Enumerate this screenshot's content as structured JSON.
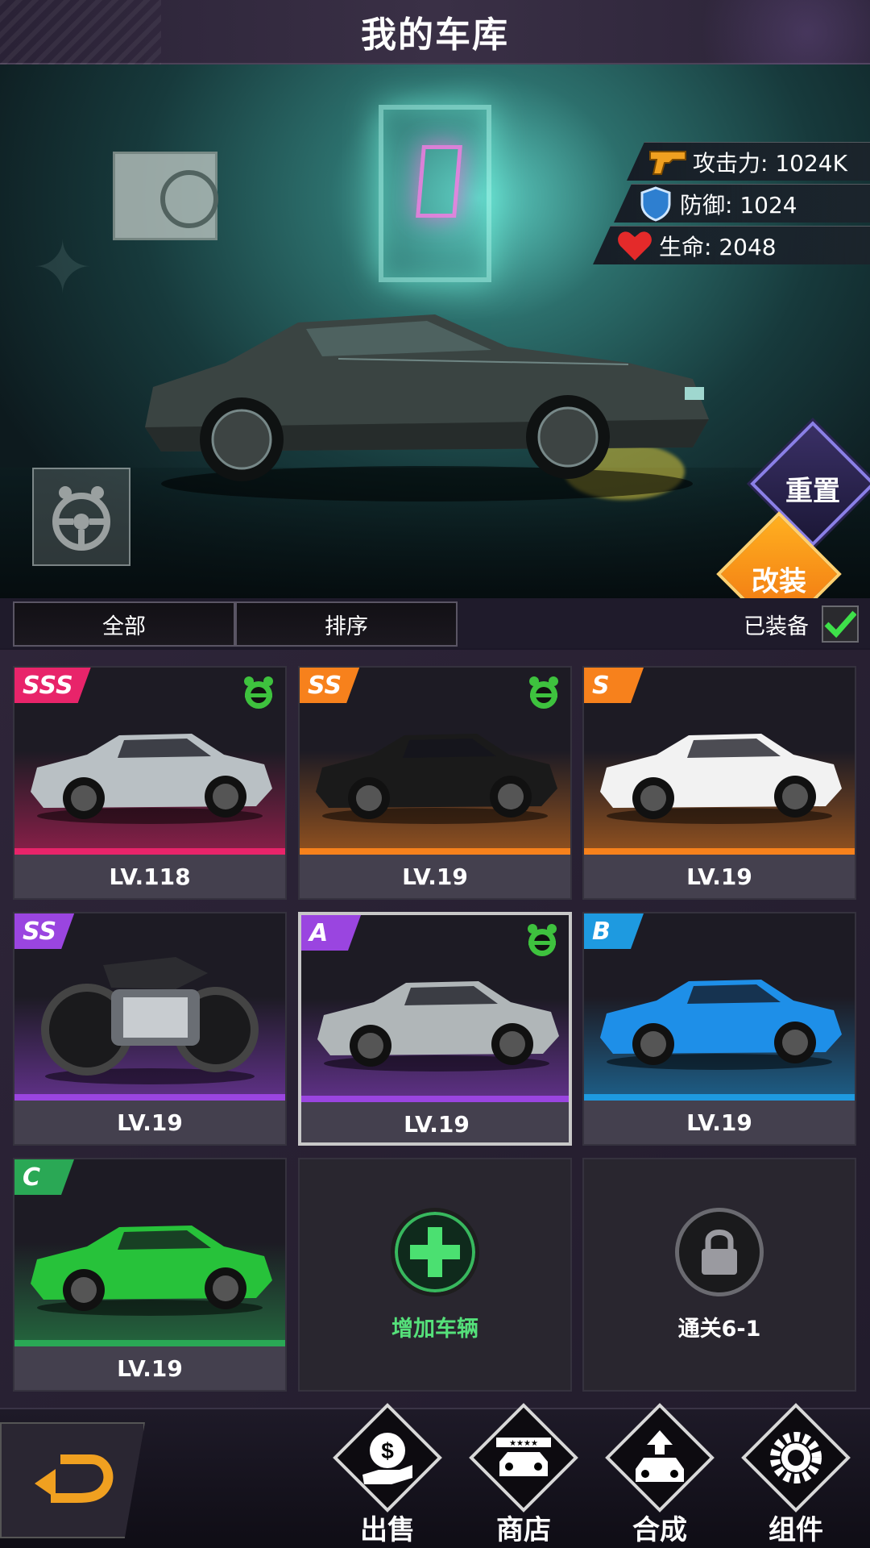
{
  "header": {
    "title": "我的车库"
  },
  "stats": {
    "attack": "攻击力: 1024K",
    "defense": "防御: 1024",
    "life": "生命: 2048"
  },
  "actions": {
    "reset": "重置",
    "modify": "改装"
  },
  "filters": {
    "all": "全部",
    "sort": "排序",
    "equipped_label": "已装备",
    "equipped_checked": true
  },
  "cars": [
    {
      "rank": "SSS",
      "level": "LV.118",
      "equipped": true,
      "color": "#e8246a",
      "body": "#b9c0c4"
    },
    {
      "rank": "SS",
      "level": "LV.19",
      "equipped": true,
      "color": "#f7811c",
      "body": "#1a1a1a"
    },
    {
      "rank": "S",
      "level": "LV.19",
      "equipped": false,
      "color": "#f7811c",
      "body": "#f2f2f2"
    },
    {
      "rank": "SS",
      "level": "LV.19",
      "equipped": false,
      "color": "#9a45e0",
      "body": "#2a2a2e"
    },
    {
      "rank": "A",
      "level": "LV.19",
      "equipped": true,
      "color": "#9a45e0",
      "body": "#b0b6b8"
    },
    {
      "rank": "B",
      "level": "LV.19",
      "equipped": false,
      "color": "#1e9ae0",
      "body": "#1e8fe8"
    },
    {
      "rank": "C",
      "level": "LV.19",
      "equipped": false,
      "color": "#2aa855",
      "body": "#27c23a"
    }
  ],
  "add_vehicle": "增加车辆",
  "locked_slot": "通关6-1",
  "bottom_nav": {
    "sell": "出售",
    "shop": "商店",
    "synthesize": "合成",
    "components": "组件"
  }
}
